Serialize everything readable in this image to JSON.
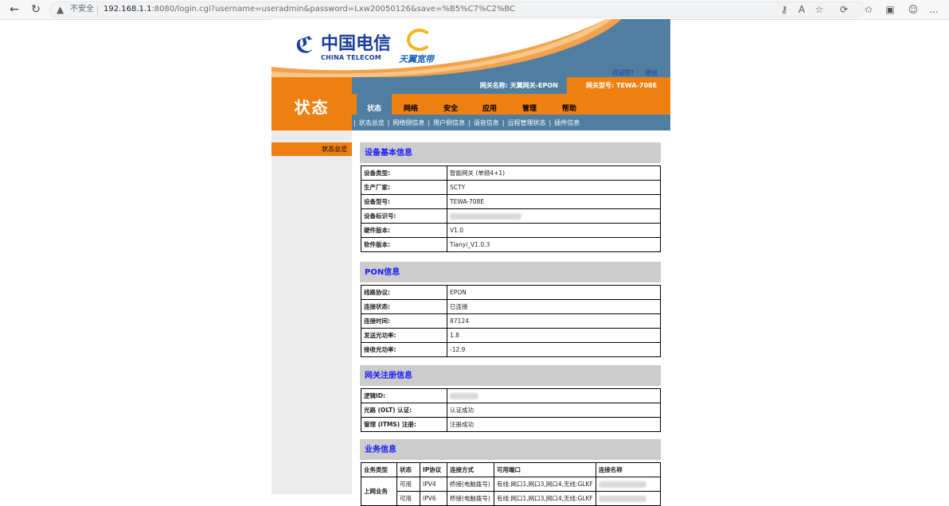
{
  "browser": {
    "security_label": "不安全",
    "url_host": "192.168.1.1",
    "url_rest": ":8080/login.cgi?username=useradmin&password=Lxw20050126&save=%B5%C7%C2%BC"
  },
  "header": {
    "logo_cn": "中国电信",
    "logo_en": "CHINA TELECOM",
    "tianyi_logo": "天翼宽带",
    "welcome_link": "欢迎您!",
    "logout_link": "退出"
  },
  "status_title": "状态",
  "gateway": {
    "name_label": "网关名称:",
    "name_value": "天翼网关-EPON",
    "model_label": "网关型号:",
    "model_value": "TEWA-708E"
  },
  "tabs": [
    {
      "label": "状态",
      "active": true
    },
    {
      "label": "网络",
      "active": false
    },
    {
      "label": "安全",
      "active": false
    },
    {
      "label": "应用",
      "active": false
    },
    {
      "label": "管理",
      "active": false
    },
    {
      "label": "帮助",
      "active": false
    }
  ],
  "subtabs": [
    "状态总览",
    "网络侧信息",
    "用户侧信息",
    "语音信息",
    "远程管理状态",
    "插件信息"
  ],
  "sidebar": {
    "items": [
      {
        "label": "状态总览"
      }
    ]
  },
  "device_section": {
    "title": "设备基本信息",
    "rows": [
      {
        "key": "设备类型:",
        "value": "智能网关 (单频4+1)"
      },
      {
        "key": "生产厂家:",
        "value": "SCTY"
      },
      {
        "key": "设备型号:",
        "value": "TEWA-708E"
      },
      {
        "key": "设备标识号:",
        "value": ""
      },
      {
        "key": "硬件版本:",
        "value": "V1.0"
      },
      {
        "key": "软件版本:",
        "value": "Tianyi_V1.0.3"
      }
    ]
  },
  "pon_section": {
    "title": "PON信息",
    "rows": [
      {
        "key": "线路协议:",
        "value": "EPON"
      },
      {
        "key": "连接状态:",
        "value": "已连接"
      },
      {
        "key": "连接时间:",
        "value": "87124"
      },
      {
        "key": "发送光功率:",
        "value": "1.8"
      },
      {
        "key": "接收光功率:",
        "value": "-12.9"
      }
    ]
  },
  "register_section": {
    "title": "网关注册信息",
    "rows": [
      {
        "key": "逻辑ID:",
        "value": ""
      },
      {
        "key": "光路 (OLT) 认证:",
        "value": "认证成功"
      },
      {
        "key": "管理 (ITMS) 注册:",
        "value": "注册成功"
      }
    ]
  },
  "service_section": {
    "title": "业务信息",
    "headers": [
      "业务类型",
      "状态",
      "IP协议",
      "连接方式",
      "可用端口",
      "连接名称"
    ],
    "group_label": "上网业务",
    "rows": [
      {
        "status": "可用",
        "ip": "IPV4",
        "mode": "桥接(电脑拨号)",
        "ports": "有线:网口1,网口3,网口4,无线:GLKF"
      },
      {
        "status": "可用",
        "ip": "IPV6",
        "mode": "桥接(电脑拨号)",
        "ports": "有线:网口1,网口3,网口4,无线:GLKF"
      }
    ]
  }
}
